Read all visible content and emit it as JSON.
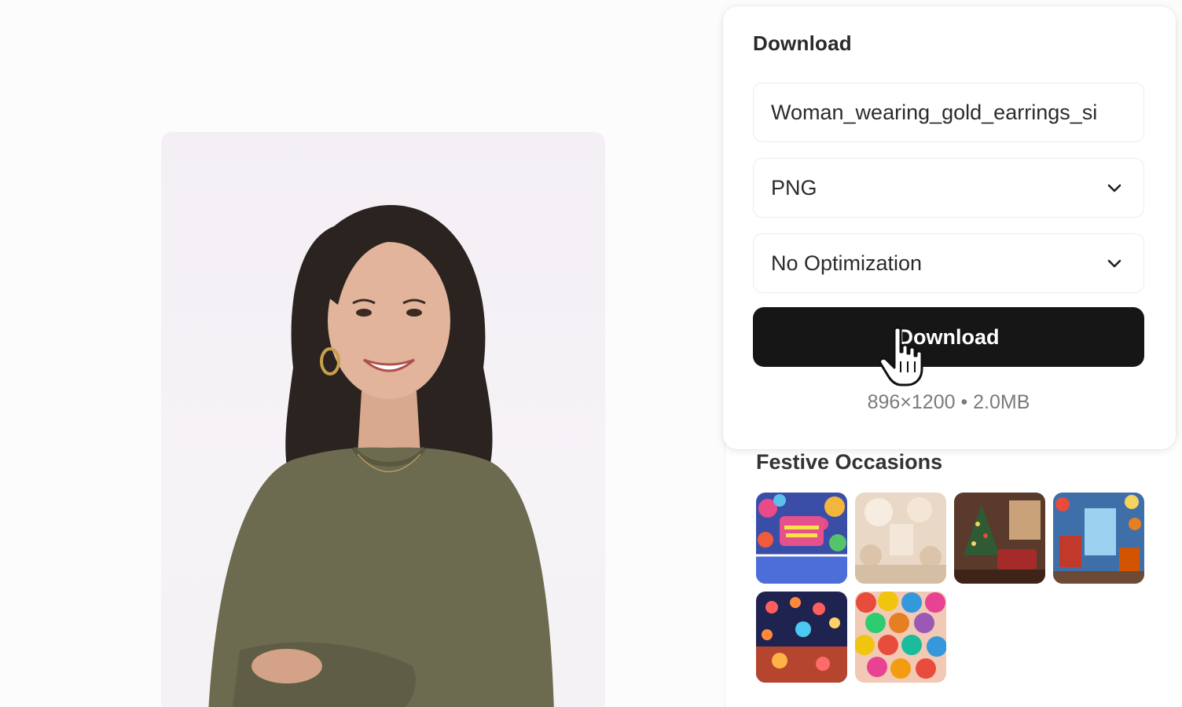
{
  "download_panel": {
    "title": "Download",
    "filename_value": "Woman_wearing_gold_earrings_si",
    "format_value": "PNG",
    "optimization_value": "No Optimization",
    "download_button_label": "Download",
    "file_info": "896×1200 • 2.0MB"
  },
  "festive_section": {
    "title": "Festive Occasions",
    "thumbnails": [
      {
        "icon": "birthday-banner-image"
      },
      {
        "icon": "cream-ballroom-image"
      },
      {
        "icon": "christmas-living-room-image"
      },
      {
        "icon": "festive-party-room-image"
      },
      {
        "icon": "lantern-street-image"
      },
      {
        "icon": "balloons-image"
      }
    ]
  },
  "colors": {
    "button_bg": "#161616",
    "button_text": "#ffffff",
    "muted_text": "#7b7b7b"
  }
}
